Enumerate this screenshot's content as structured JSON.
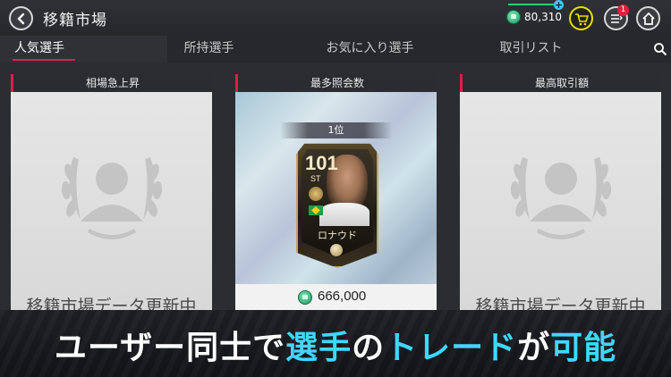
{
  "header": {
    "title": "移籍市場",
    "coins": "80,310",
    "notification_count": "1"
  },
  "tabs": [
    {
      "label": "人気選手",
      "active": true
    },
    {
      "label": "所持選手",
      "active": false
    },
    {
      "label": "お気に入り選手",
      "active": false
    },
    {
      "label": "取引リスト",
      "active": false
    }
  ],
  "cards": [
    {
      "title": "相場急上昇",
      "status": "移籍市場データ更新中"
    },
    {
      "title": "最多照会数",
      "rank": "1位",
      "player": {
        "rating": "101",
        "position": "ST",
        "name": "ロナウド",
        "nation_flag": "brazil-flag"
      },
      "price": "666,000"
    },
    {
      "title": "最高取引額",
      "status": "移籍市場データ更新中"
    }
  ],
  "banner": {
    "part1": "ユーザー同士で",
    "part2": "選手",
    "part3": "の",
    "part4": "トレード",
    "part5": "が",
    "part6": "可能"
  },
  "colors": {
    "accent": "#e21b4b",
    "coin": "#1c9d63",
    "banner_highlight": "#3fd8ff"
  }
}
